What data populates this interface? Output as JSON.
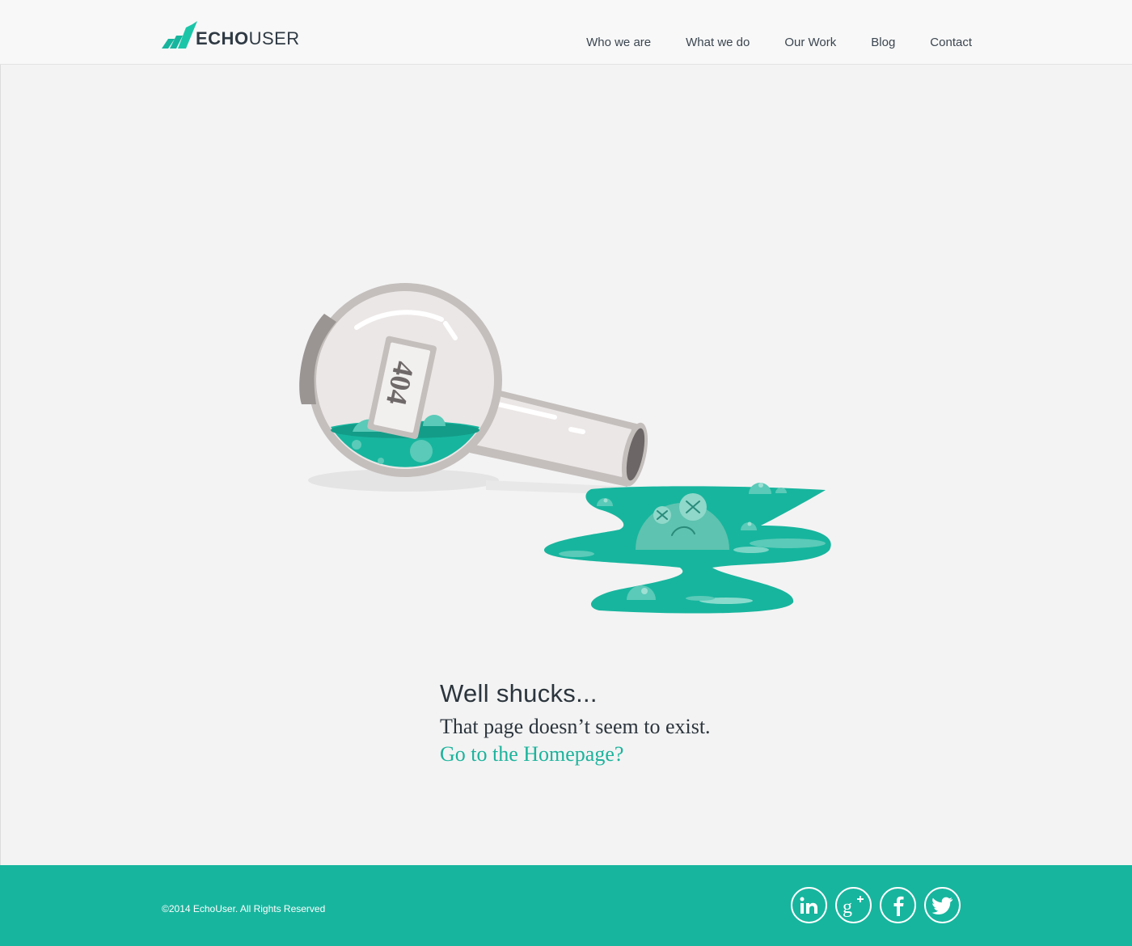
{
  "brand": {
    "logo_echo": "ECHO",
    "logo_user": "USER",
    "accent_color": "#17b59e"
  },
  "nav": {
    "items": [
      {
        "label": "Who we are"
      },
      {
        "label": "What we do"
      },
      {
        "label": "Our Work"
      },
      {
        "label": "Blog"
      },
      {
        "label": "Contact"
      }
    ]
  },
  "illustration": {
    "label_text": "404",
    "description_icon": "spilled-flask-illustration"
  },
  "message": {
    "headline": "Well shucks...",
    "body": "That page doesn’t seem to exist.",
    "link_text": "Go to the Homepage?"
  },
  "footer": {
    "copyright": "©2014 EchoUser. All Rights Reserved",
    "social": [
      {
        "icon": "linkedin-icon"
      },
      {
        "icon": "google-plus-icon"
      },
      {
        "icon": "facebook-icon"
      },
      {
        "icon": "twitter-icon"
      }
    ]
  }
}
